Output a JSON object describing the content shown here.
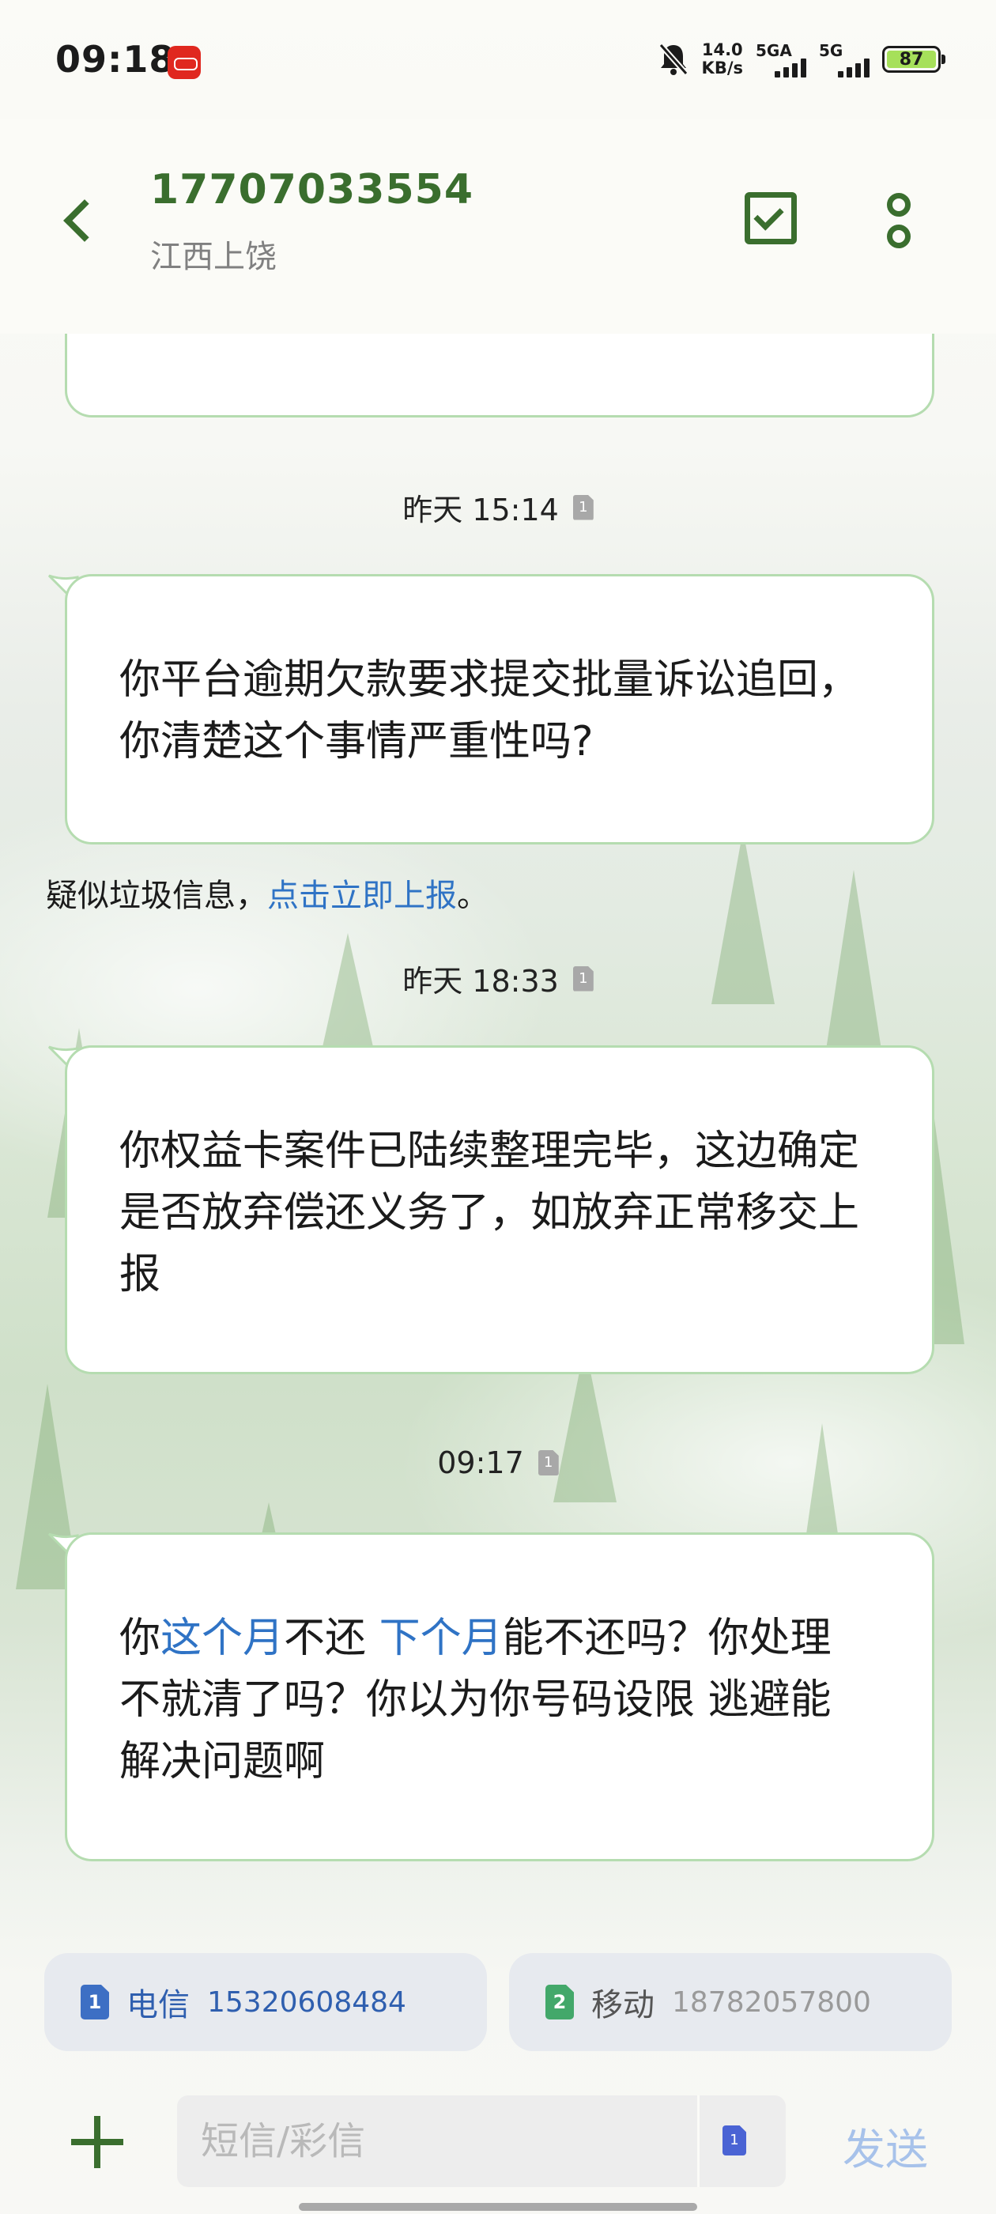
{
  "status_bar": {
    "time": "09:18",
    "speed_value": "14.0",
    "speed_unit": "KB/s",
    "net1_label": "5GA",
    "net2_label": "5G",
    "battery": "87"
  },
  "header": {
    "contact_number": "17707033554",
    "contact_location": "江西上饶"
  },
  "messages": [
    {
      "timestamp": "昨天 15:14",
      "sim": "1",
      "text": "你平台逾期欠款要求提交批量诉讼追回，你清楚这个事情严重性吗?"
    },
    {
      "timestamp": "昨天 18:33",
      "sim": "1",
      "text": "你权益卡案件已陆续整理完毕，这边确定是否放弃偿还义务了，如放弃正常移交上报"
    },
    {
      "timestamp": "09:17",
      "sim": "1",
      "parts": [
        "你",
        "这个月",
        "不还 ",
        "下个月",
        "能不还吗？你处理不就清了吗？你以为你号码设限 逃避能解决问题啊"
      ]
    }
  ],
  "spam_notice": {
    "prefix": "疑似垃圾信息，",
    "link": "点击立即上报",
    "suffix": "。"
  },
  "sim_selector": [
    {
      "index": "1",
      "carrier": "电信",
      "number": "15320608484",
      "color": "#3d6fc4"
    },
    {
      "index": "2",
      "carrier": "移动",
      "number": "18782057800",
      "color": "#43a86a"
    }
  ],
  "composer": {
    "placeholder": "短信/彩信",
    "sim_index": "1",
    "send_label": "发送"
  },
  "colors": {
    "accent_green": "#3a6e2e",
    "bubble_border": "#b5dcb0",
    "link_blue": "#2f73c5"
  }
}
